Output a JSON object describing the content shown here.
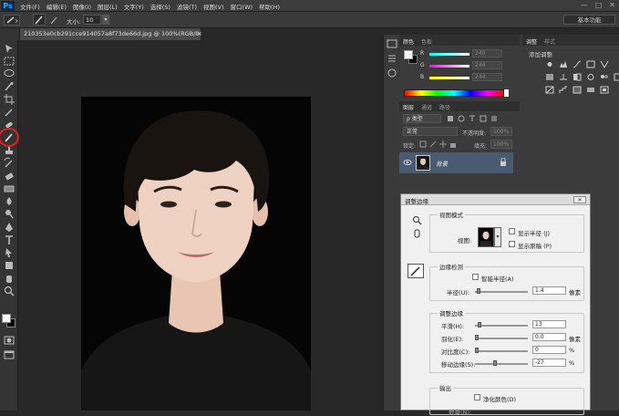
{
  "app": {
    "logo": "Ps"
  },
  "menu": [
    "文件(F)",
    "编辑(E)",
    "图像(I)",
    "图层(L)",
    "文字(Y)",
    "选择(S)",
    "滤镜(T)",
    "视图(V)",
    "窗口(W)",
    "帮助(H)"
  ],
  "window_controls": [
    "—",
    "□",
    "✕"
  ],
  "options_bar": {
    "size_label": "大小:",
    "size_value": "10",
    "workspace": "基本功能"
  },
  "document": {
    "tab_title": "210353e0cb291cce914057a8f73de66d.jpg @ 100%(RGB/8#)",
    "close": "×"
  },
  "tools": [
    "move-tool-icon",
    "marquee-tool-icon",
    "lasso-tool-icon",
    "quick-select-tool-icon",
    "crop-tool-icon",
    "eyedropper-tool-icon",
    "spot-heal-tool-icon",
    "brush-tool-icon",
    "stamp-tool-icon",
    "history-brush-tool-icon",
    "eraser-tool-icon",
    "gradient-tool-icon",
    "blur-tool-icon",
    "dodge-tool-icon",
    "pen-tool-icon",
    "type-tool-icon",
    "path-select-tool-icon",
    "shape-tool-icon",
    "hand-tool-icon",
    "zoom-tool-icon"
  ],
  "color_panel": {
    "tabs": [
      "颜色",
      "色板"
    ],
    "channels": [
      {
        "name": "R",
        "value": "240"
      },
      {
        "name": "G",
        "value": "244"
      },
      {
        "name": "B",
        "value": "244"
      }
    ]
  },
  "adjust_panel": {
    "tabs": [
      "调整",
      "样式"
    ],
    "title": "添加调整"
  },
  "layers_panel": {
    "tabs": [
      "图层",
      "通道",
      "路径"
    ],
    "kind": "ρ 类型",
    "blend": "正常",
    "opacity_label": "不透明度:",
    "opacity_value": "100%",
    "lock_label": "锁定:",
    "fill_label": "填充:",
    "fill_value": "100%",
    "layer_name": "背景"
  },
  "refine_dialog": {
    "title": "调整边缘",
    "close": "✕",
    "view_mode": {
      "title": "视图模式",
      "view_label": "视图:",
      "show_radius": "显示半径 (J)",
      "show_original": "显示原稿 (P)"
    },
    "edge_detection": {
      "title": "边缘检测",
      "smart_radius": "智能半径(A)",
      "radius_label": "半径(U):",
      "radius_value": "1.4",
      "radius_unit": "像素"
    },
    "adjust_edge": {
      "title": "调整边缘",
      "rows": [
        {
          "label": "平滑(H):",
          "value": "13",
          "unit": "",
          "pos": 0.06
        },
        {
          "label": "羽化(E):",
          "value": "0.0",
          "unit": "像素",
          "pos": 0.0
        },
        {
          "label": "对比度(C):",
          "value": "0",
          "unit": "%",
          "pos": 0.0
        },
        {
          "label": "移动边缘(S):",
          "value": "-27",
          "unit": "%",
          "pos": 0.37
        }
      ]
    },
    "output": {
      "title": "输出",
      "decontaminate": "净化颜色(D)",
      "amount_label": "数量(N):"
    }
  }
}
